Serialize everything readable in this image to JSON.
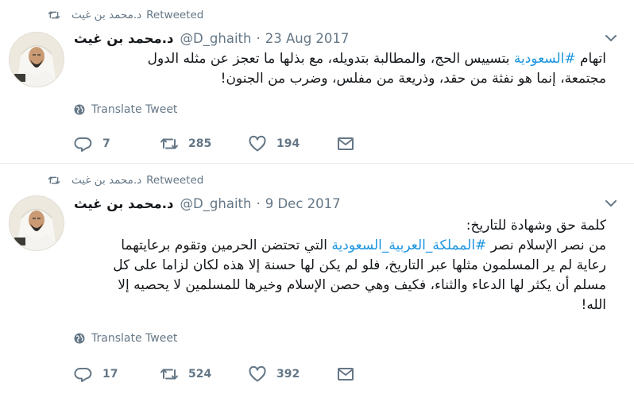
{
  "tweets": [
    {
      "retweeted_by": "د.محمد بن غيث",
      "retweeted_label": "Retweeted",
      "fullname": "د.محمد بن غيث",
      "handle": "@D_ghaith",
      "separator": "·",
      "date": "23 Aug 2017",
      "text_lines": [
        [
          {
            "t": "اتهام ",
            "tag": false
          },
          {
            "t": "#السعودية",
            "tag": true
          },
          {
            "t": " بتسييس الحج، والمطالبة بتدويله، مع بذلها ما تعجز عن مثله الدول",
            "tag": false
          }
        ],
        [
          {
            "t": "مجتمعة، إنما هو نفثة من حقد، وذريعة من مفلس، وضرب من الجنون!",
            "tag": false
          }
        ]
      ],
      "translate_label": "Translate Tweet",
      "counts": {
        "replies": "7",
        "retweets": "285",
        "likes": "194"
      }
    },
    {
      "retweeted_by": "د.محمد بن غيث",
      "retweeted_label": "Retweeted",
      "fullname": "د.محمد بن غيث",
      "handle": "@D_ghaith",
      "separator": "·",
      "date": "9 Dec 2017",
      "text_lines": [
        [
          {
            "t": "كلمة حق وشهادة للتاريخ:",
            "tag": false
          }
        ],
        [
          {
            "t": "من نصر الإسلام نصر ",
            "tag": false
          },
          {
            "t": "#المملكة_العربية_السعودية",
            "tag": true
          },
          {
            "t": " التي تحتضن الحرمين وتقوم برعايتهما",
            "tag": false
          }
        ],
        [
          {
            "t": "رعاية لم ير المسلمون مثلها عبر التاريخ، فلو لم يكن لها حسنة إلا هذه لكان لزاما على كل",
            "tag": false
          }
        ],
        [
          {
            "t": "مسلم أن يكثر لها الدعاء والثناء، فكيف وهي حصن الإسلام وخيرها للمسلمين لا يحصيه إلا",
            "tag": false
          }
        ],
        [
          {
            "t": "الله!",
            "tag": false
          }
        ]
      ],
      "translate_label": "Translate Tweet",
      "counts": {
        "replies": "17",
        "retweets": "524",
        "likes": "392"
      }
    }
  ],
  "icons": {
    "retweet": "retweet-icon",
    "reply": "reply-icon",
    "like": "heart-icon",
    "dm": "envelope-icon",
    "translate": "globe-icon",
    "more": "chevron-down-icon"
  },
  "colors": {
    "text": "#14171a",
    "secondary": "#657786",
    "hashtag": "#1b95e0",
    "divider": "#e6ecf0"
  }
}
